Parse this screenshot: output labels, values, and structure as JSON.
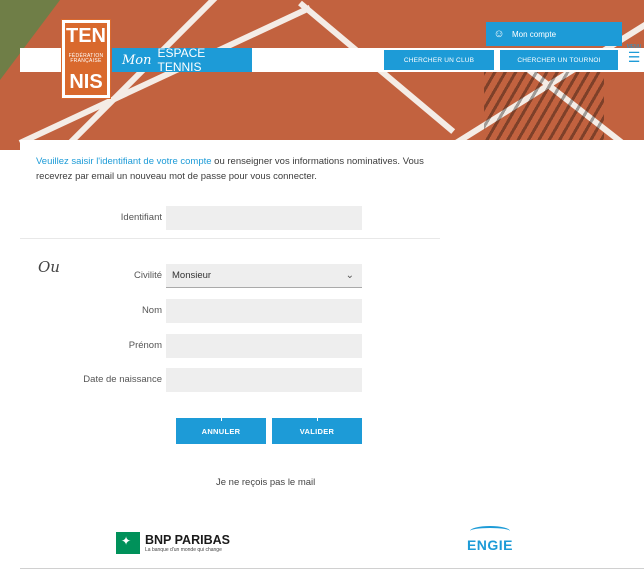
{
  "header": {
    "logo_top": "TEN",
    "logo_small": "FÉDÉRATION FRANÇAISE",
    "logo_bottom": "NIS",
    "mon": "Mon",
    "espace": "ESPACE TENNIS",
    "account_label": "Mon compte",
    "account_icon": "user-icon",
    "btn_club": "CHERCHER UN CLUB",
    "btn_tournoi": "CHERCHER UN TOURNOI",
    "menu_label": "MENU",
    "menu_icon": "hamburger-icon"
  },
  "intro": {
    "highlight": "Veuillez saisir l'identifiant de votre compte",
    "rest": " ou renseigner vos informations nominatives. Vous recevrez par email un nouveau mot de passe pour vous connecter."
  },
  "form": {
    "identifiant_label": "Identifiant",
    "identifiant_value": "",
    "ou": "Ou",
    "civilite_label": "Civilité",
    "civilite_value": "Monsieur",
    "nom_label": "Nom",
    "nom_value": "",
    "prenom_label": "Prénom",
    "prenom_value": "",
    "naissance_label": "Date de naissance",
    "naissance_value": ""
  },
  "actions": {
    "annuler": "ANNULER",
    "valider": "VALIDER",
    "no_mail": "Je ne reçois pas le mail"
  },
  "sponsors": {
    "bnp_name": "BNP PARIBAS",
    "bnp_tag": "La banque d'un monde qui change",
    "engie": "ENGIE"
  },
  "colors": {
    "accent": "#1d9bd7",
    "court": "#c2623f",
    "logo_orange": "#d9692d",
    "bnp_green": "#00915a"
  }
}
